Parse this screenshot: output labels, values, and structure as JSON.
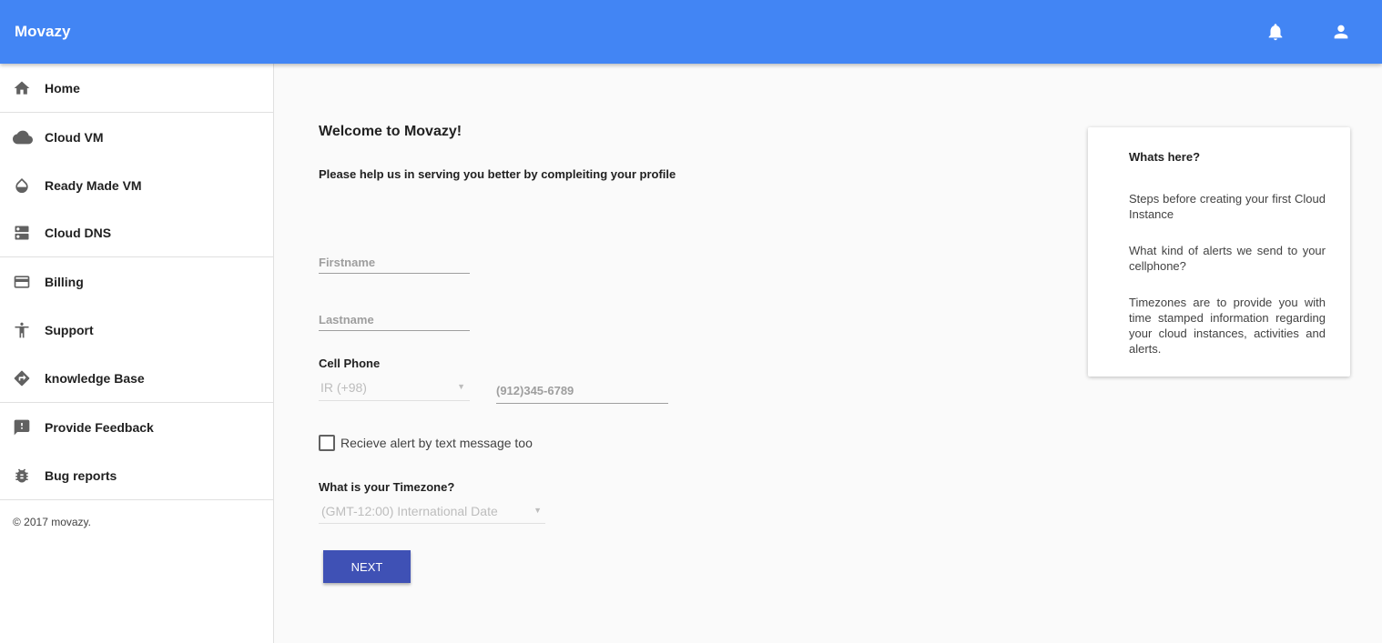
{
  "app": {
    "brand": "Movazy",
    "accent_color": "#4285f4",
    "button_color": "#3f51b5"
  },
  "topbar": {
    "icons": [
      "bell-icon",
      "account-icon"
    ]
  },
  "sidebar": {
    "items": [
      {
        "label": "Home",
        "icon": "home-icon"
      },
      {
        "label": "Cloud VM",
        "icon": "cloud-icon"
      },
      {
        "label": "Ready Made VM",
        "icon": "droplet-icon"
      },
      {
        "label": "Cloud DNS",
        "icon": "dns-icon"
      },
      {
        "label": "Billing",
        "icon": "credit-card-icon"
      },
      {
        "label": "Support",
        "icon": "accessibility-icon"
      },
      {
        "label": "knowledge Base",
        "icon": "directions-icon"
      },
      {
        "label": "Provide Feedback",
        "icon": "feedback-icon"
      },
      {
        "label": "Bug reports",
        "icon": "bug-icon"
      }
    ],
    "copyright": "© 2017 movazy."
  },
  "main": {
    "welcome": "Welcome to Movazy!",
    "subtitle": "Please help us in serving you better by compleiting your profile",
    "firstname_placeholder": "Firstname",
    "lastname_placeholder": "Lastname",
    "cell_phone_label": "Cell Phone",
    "country_code_value": "IR (+98)",
    "phone_placeholder": "(912)345-6789",
    "checkbox_label": "Recieve alert by text message too",
    "checkbox_checked": false,
    "timezone_label": "What is your Timezone?",
    "timezone_value": "(GMT-12:00) International Date",
    "next_button": "NEXT"
  },
  "info_card": {
    "title": "Whats here?",
    "paragraphs": [
      "Steps before creating your first Cloud Instance",
      "What kind of alerts we send to your cellphone?",
      "Timezones are to provide you with time stamped information regarding your cloud instances, activities and alerts."
    ]
  }
}
